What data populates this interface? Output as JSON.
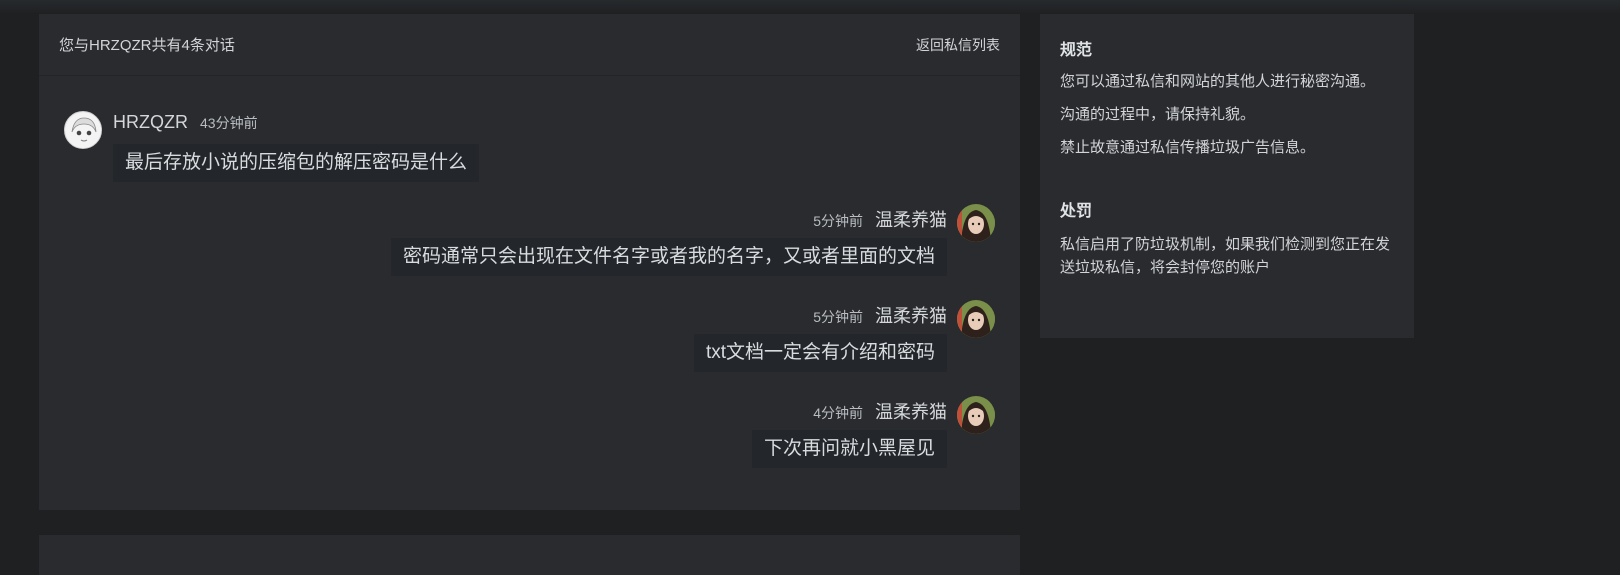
{
  "conversation": {
    "title": "您与HRZQZR共有4条对话",
    "back_link": "返回私信列表",
    "messages": [
      {
        "sender": "HRZQZR",
        "time": "43分钟前",
        "text": "最后存放小说的压缩包的解压密码是什么",
        "side": "left",
        "avatar": "anime-girl-avatar"
      },
      {
        "sender": "温柔养猫",
        "time": "5分钟前",
        "text": "密码通常只会出现在文件名字或者我的名字，又或者里面的文档",
        "side": "right",
        "avatar": "girl-photo-avatar"
      },
      {
        "sender": "温柔养猫",
        "time": "5分钟前",
        "text": "txt文档一定会有介绍和密码",
        "side": "right",
        "avatar": "girl-photo-avatar"
      },
      {
        "sender": "温柔养猫",
        "time": "4分钟前",
        "text": "下次再问就小黑屋见",
        "side": "right",
        "avatar": "girl-photo-avatar"
      }
    ]
  },
  "sidebar": {
    "rules": {
      "heading": "规范",
      "lines": [
        "您可以通过私信和网站的其他人进行秘密沟通。",
        "沟通的过程中，请保持礼貌。",
        "禁止故意通过私信传播垃圾广告信息。"
      ]
    },
    "penalty": {
      "heading": "处罚",
      "text": "私信启用了防垃圾机制，如果我们检测到您正在发送垃圾私信，将会封停您的账户"
    }
  },
  "colors": {
    "page_bg": "#1e2022",
    "panel_bg": "#292b2e",
    "bubble_bg": "#23262a"
  }
}
